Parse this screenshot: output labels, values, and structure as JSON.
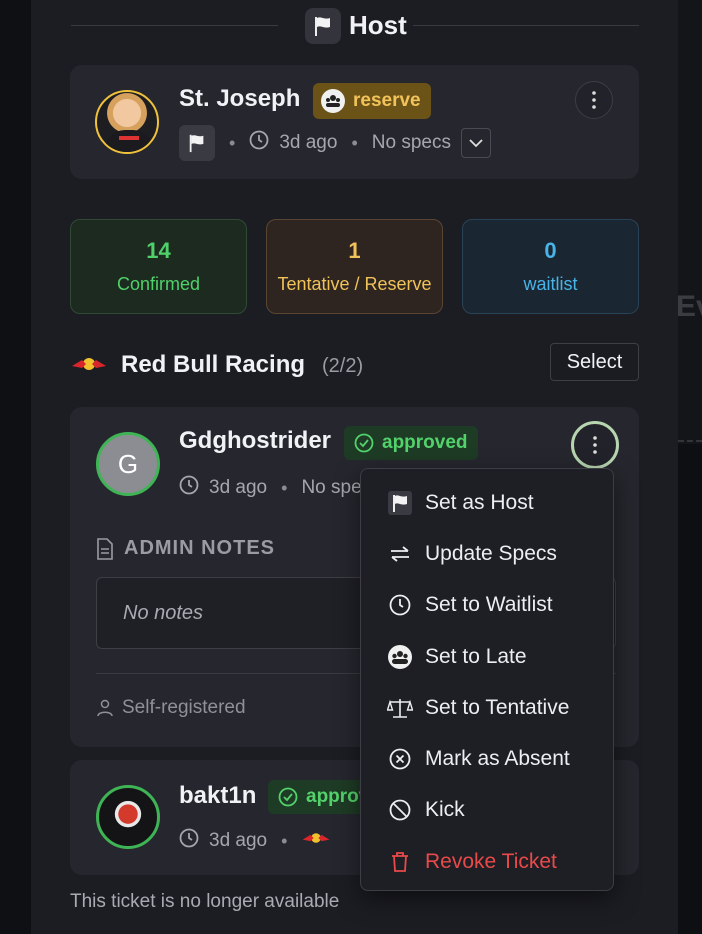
{
  "section_title": "Host",
  "host": {
    "name": "St. Joseph",
    "badge": "reserve",
    "time": "3d ago",
    "specs": "No specs"
  },
  "stats": [
    {
      "value": "14",
      "label": "Confirmed",
      "color": "#4fd16a"
    },
    {
      "value": "1",
      "label": "Tentative / Reserve",
      "color": "#f0c25a"
    },
    {
      "value": "0",
      "label": "waitlist",
      "color": "#49b4e8"
    }
  ],
  "team": {
    "name": "Red Bull Racing",
    "count": "(2/2)",
    "select_label": "Select"
  },
  "participants": [
    {
      "name": "Gdghostrider",
      "initial": "G",
      "status": "approved",
      "time": "3d ago",
      "specs_partial": "No spe",
      "notes_header": "ADMIN NOTES",
      "notes_placeholder": "No notes",
      "registration": "Self-registered"
    },
    {
      "name": "bakt1n",
      "status": "approv",
      "time": "3d ago"
    }
  ],
  "footer_note": "This ticket is no longer available",
  "menu": {
    "items": [
      {
        "label": "Set as Host",
        "icon": "flag-icon"
      },
      {
        "label": "Update Specs",
        "icon": "swap-arrows-icon"
      },
      {
        "label": "Set to Waitlist",
        "icon": "clock-icon"
      },
      {
        "label": "Set to Late",
        "icon": "late-icon"
      },
      {
        "label": "Set to Tentative",
        "icon": "scale-icon"
      },
      {
        "label": "Mark as Absent",
        "icon": "x-circle-icon"
      },
      {
        "label": "Kick",
        "icon": "ban-icon"
      },
      {
        "label": "Revoke Ticket",
        "icon": "trash-icon",
        "danger": true
      }
    ]
  },
  "background_partial_text": "Ev",
  "colors": {
    "confirmed": "#4fd16a",
    "tentative": "#f0c25a",
    "waitlist": "#49b4e8",
    "danger": "#e84a4a",
    "approved": "#53d26b"
  }
}
